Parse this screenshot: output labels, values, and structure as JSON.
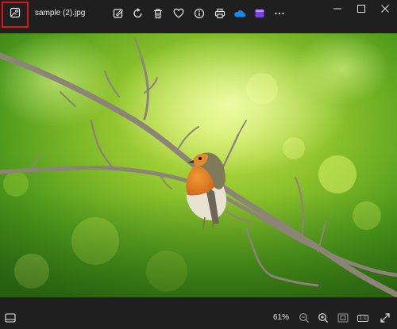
{
  "window": {
    "file_name": "sample (2).jpg"
  },
  "toolbar": {
    "icons": [
      "gallery-icon",
      "edit-image-icon",
      "rotate-icon",
      "delete-icon",
      "favorite-icon",
      "info-icon",
      "print-icon",
      "onedrive-icon",
      "clipchamp-icon",
      "more-icon"
    ]
  },
  "window_controls": [
    "minimize-icon",
    "maximize-icon",
    "close-icon"
  ],
  "image": {
    "subject": "robin-on-branch-photo"
  },
  "bottom_bar": {
    "zoom_percent": "61%",
    "ratio_label": "1:1"
  },
  "colors": {
    "background": "#1f1f1f",
    "highlight": "#e0141a",
    "onedrive": "#1e88e5",
    "clipchamp": "#7a3cf0"
  }
}
